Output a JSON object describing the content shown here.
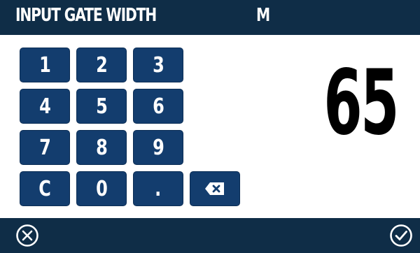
{
  "header": {
    "title": "INPUT GATE WIDTH",
    "unit": "M"
  },
  "display": {
    "value": "65"
  },
  "keypad": {
    "k1": "1",
    "k2": "2",
    "k3": "3",
    "k4": "4",
    "k5": "5",
    "k6": "6",
    "k7": "7",
    "k8": "8",
    "k9": "9",
    "clear": "C",
    "k0": "0",
    "dot": "."
  },
  "icons": {
    "backspace": "backspace-icon",
    "cancel": "cancel-icon",
    "confirm": "confirm-icon"
  },
  "colors": {
    "bar": "#0f2d47",
    "key": "#133d6e",
    "text": "#ffffff"
  }
}
